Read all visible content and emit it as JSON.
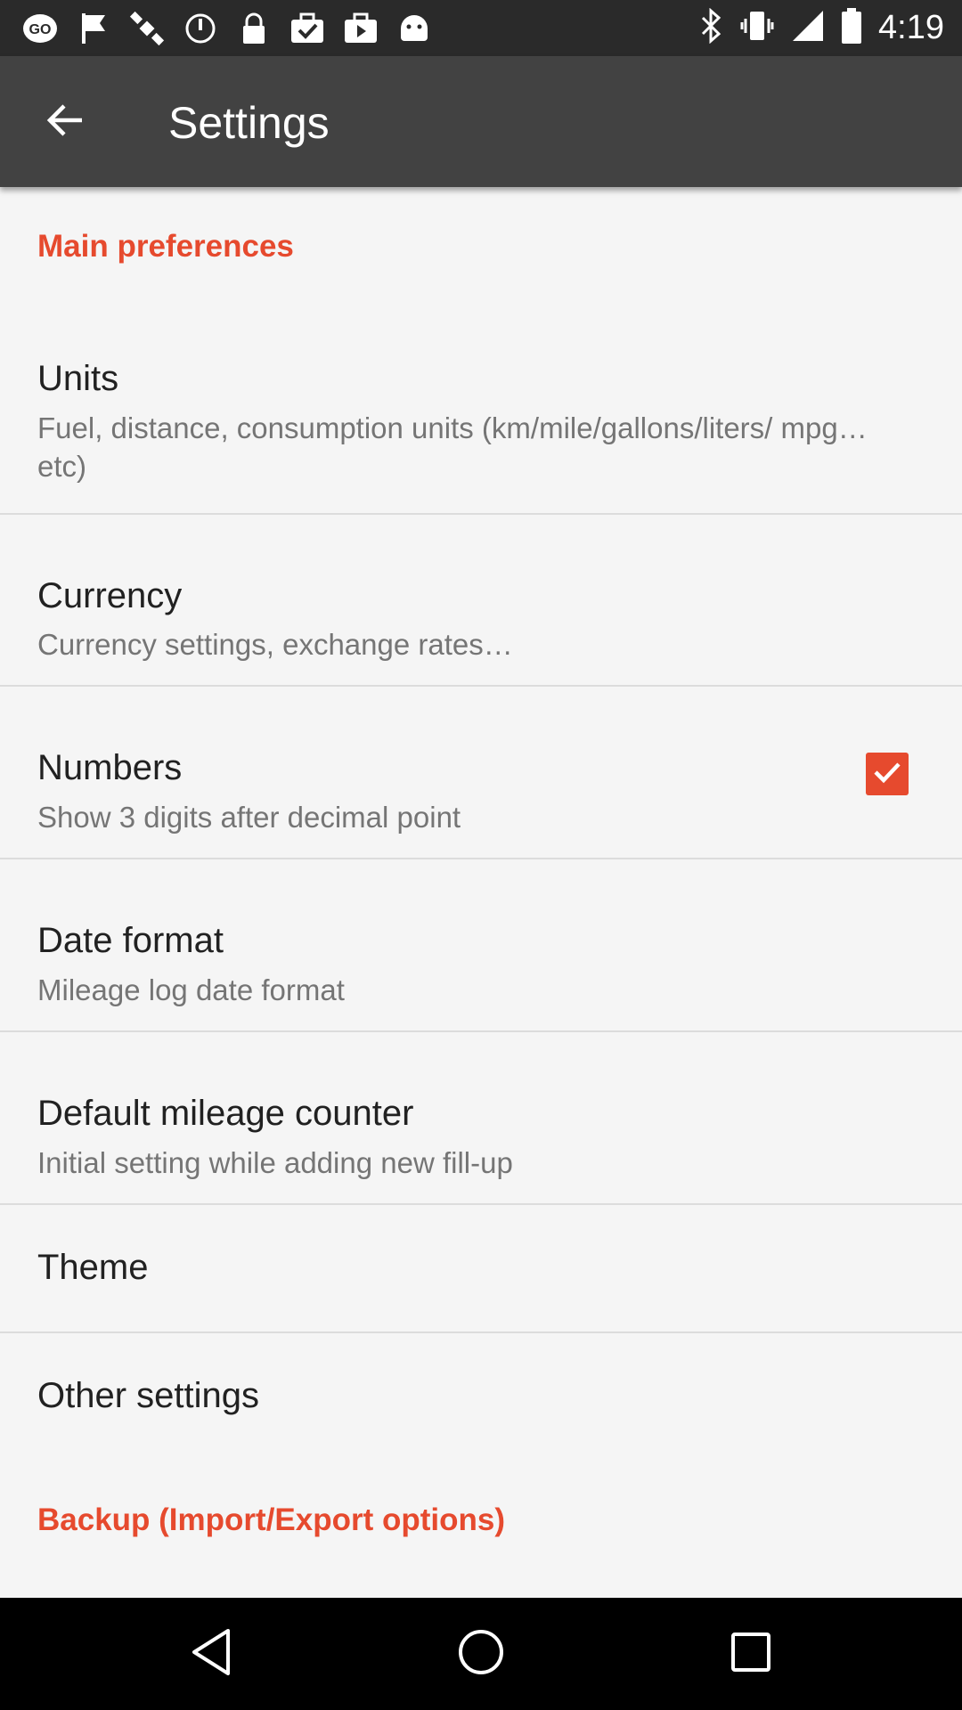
{
  "status_bar": {
    "time": "4:19",
    "left_icons": [
      "go-app-icon",
      "flag-icon",
      "satellite-icon",
      "alarm-icon",
      "lock-icon",
      "briefcase-check-icon",
      "shopping-bag-icon",
      "android-icon"
    ],
    "right_icons": [
      "bluetooth-icon",
      "vibrate-icon",
      "signal-icon",
      "battery-icon"
    ]
  },
  "app_bar": {
    "title": "Settings",
    "back_icon": "arrow-back-icon"
  },
  "sections": {
    "main_header": "Main preferences",
    "backup_header": "Backup (Import/Export options)"
  },
  "prefs": {
    "units": {
      "title": "Units",
      "summary": "Fuel, distance, consumption units (km/mile/gallons/liters/ mpg… etc)"
    },
    "currency": {
      "title": "Currency",
      "summary": "Currency settings, exchange rates…"
    },
    "numbers": {
      "title": "Numbers",
      "summary": "Show 3 digits after decimal point",
      "checked": true
    },
    "date_format": {
      "title": "Date format",
      "summary": "Mileage log date format"
    },
    "default_mileage": {
      "title": "Default mileage counter",
      "summary": "Initial setting while adding new fill-up"
    },
    "theme": {
      "title": "Theme"
    },
    "other": {
      "title": "Other settings"
    }
  },
  "colors": {
    "accent": "#e64a2e",
    "app_bar": "#424242",
    "status_bar": "#2a2a2a",
    "background": "#f5f5f5"
  },
  "nav_bar": {
    "icons": [
      "back-triangle-icon",
      "home-circle-icon",
      "recents-square-icon"
    ]
  }
}
